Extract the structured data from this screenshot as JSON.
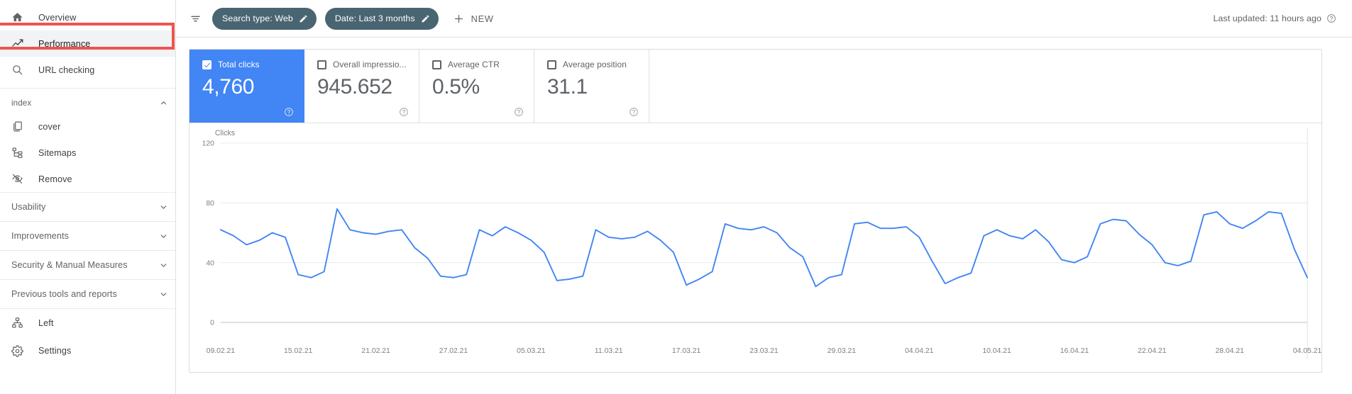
{
  "sidebar": {
    "primary_items": [
      {
        "label": "Overview",
        "icon": "home-icon",
        "selected": false
      },
      {
        "label": "Performance",
        "icon": "trending-up-icon",
        "selected": true
      },
      {
        "label": "URL checking",
        "icon": "search-icon",
        "selected": false
      }
    ],
    "index_section": {
      "label": "index",
      "collapse_icon": "chevron-up-icon",
      "items": [
        {
          "label": "cover",
          "icon": "pages-icon"
        },
        {
          "label": "Sitemaps",
          "icon": "sitemap-icon"
        },
        {
          "label": "Remove",
          "icon": "eye-off-icon"
        }
      ]
    },
    "groups": [
      {
        "label": "Usability",
        "collapse_icon": "chevron-down-icon"
      },
      {
        "label": "Improvements",
        "collapse_icon": "chevron-down-icon"
      },
      {
        "label": "Security & Manual Measures",
        "collapse_icon": "chevron-down-icon"
      },
      {
        "label": "Previous tools and reports",
        "collapse_icon": "chevron-down-icon"
      }
    ],
    "bottom_items": [
      {
        "label": "Left",
        "icon": "hierarchy-icon"
      },
      {
        "label": "Settings",
        "icon": "gear-icon"
      }
    ],
    "highlight_color": "#ef5350"
  },
  "topbar": {
    "filter_icon": "filter-icon",
    "chips": [
      {
        "label": "Search type: Web",
        "edit_icon": "pencil-icon"
      },
      {
        "label": "Date: Last 3 months",
        "edit_icon": "pencil-icon"
      }
    ],
    "new_button": {
      "label": "NEW",
      "icon": "plus-icon"
    },
    "last_updated": {
      "text": "Last updated: 11 hours ago",
      "help_icon": "help-circle-icon"
    },
    "chip_color": "#4a6572"
  },
  "metrics": [
    {
      "label": "Total clicks",
      "value": "4,760",
      "checked": true,
      "active": true,
      "help_icon": "help-circle-icon"
    },
    {
      "label": "Overall impressio...",
      "value": "945.652",
      "checked": false,
      "active": false,
      "help_icon": "help-circle-icon"
    },
    {
      "label": "Average CTR",
      "value": "0.5%",
      "checked": false,
      "active": false,
      "help_icon": "help-circle-icon"
    },
    {
      "label": "Average position",
      "value": "31.1",
      "checked": false,
      "active": false,
      "help_icon": "help-circle-icon"
    }
  ],
  "chart_data": {
    "type": "line",
    "title": "",
    "ylabel": "Clicks",
    "xlabel": "",
    "ylim": [
      0,
      120
    ],
    "yticks": [
      0,
      40,
      80,
      120
    ],
    "grid": true,
    "legend": null,
    "line_color": "#4285f4",
    "xtick_labels": [
      "09.02.21",
      "15.02.21",
      "21.02.21",
      "27.02.21",
      "05.03.21",
      "11.03.21",
      "17.03.21",
      "23.03.21",
      "29.03.21",
      "04.04.21",
      "10.04.21",
      "16.04.21",
      "22.04.21",
      "28.04.21",
      "04.05.21"
    ],
    "xtick_indices": [
      0,
      6,
      12,
      18,
      24,
      30,
      36,
      42,
      48,
      54,
      60,
      66,
      72,
      78,
      84
    ],
    "series": [
      {
        "name": "Clicks",
        "values": [
          62,
          58,
          52,
          55,
          60,
          57,
          32,
          30,
          34,
          76,
          62,
          60,
          59,
          61,
          62,
          50,
          43,
          31,
          30,
          32,
          62,
          58,
          64,
          60,
          55,
          47,
          28,
          29,
          31,
          62,
          57,
          56,
          57,
          61,
          55,
          47,
          25,
          29,
          34,
          66,
          63,
          62,
          64,
          60,
          50,
          44,
          24,
          30,
          32,
          66,
          67,
          63,
          63,
          64,
          57,
          41,
          26,
          30,
          33,
          58,
          62,
          58,
          56,
          62,
          54,
          42,
          40,
          44,
          66,
          69,
          68,
          59,
          52,
          40,
          38,
          41,
          72,
          74,
          66,
          63,
          68,
          74,
          73,
          49,
          30
        ]
      }
    ]
  }
}
